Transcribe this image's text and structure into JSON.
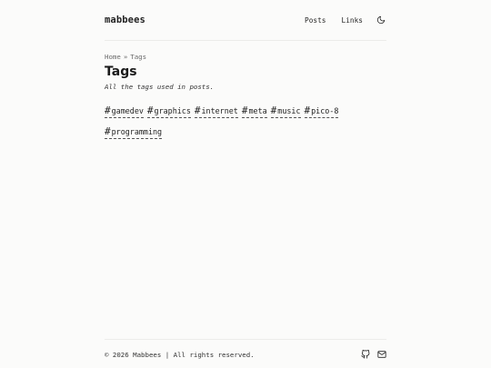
{
  "header": {
    "brand": "mabbees",
    "nav": [
      {
        "label": "Posts"
      },
      {
        "label": "Links"
      }
    ],
    "theme_toggle_icon": "moon-icon"
  },
  "breadcrumb": {
    "home": "Home",
    "separator": "»",
    "current": "Tags"
  },
  "main": {
    "title": "Tags",
    "description": "All the tags used in posts."
  },
  "tags": [
    {
      "hash": "#",
      "label": "gamedev"
    },
    {
      "hash": "#",
      "label": "graphics"
    },
    {
      "hash": "#",
      "label": "internet"
    },
    {
      "hash": "#",
      "label": "meta"
    },
    {
      "hash": "#",
      "label": "music"
    },
    {
      "hash": "#",
      "label": "pico-8"
    },
    {
      "hash": "#",
      "label": "programming"
    }
  ],
  "footer": {
    "copyright": "© 2026 Mabbees | All rights reserved.",
    "icons": [
      "github-icon",
      "mail-icon"
    ]
  },
  "colors": {
    "background": "#fbfbfa",
    "text": "#1f1f1f",
    "muted": "#6b6b6b",
    "divider": "#ececea"
  }
}
